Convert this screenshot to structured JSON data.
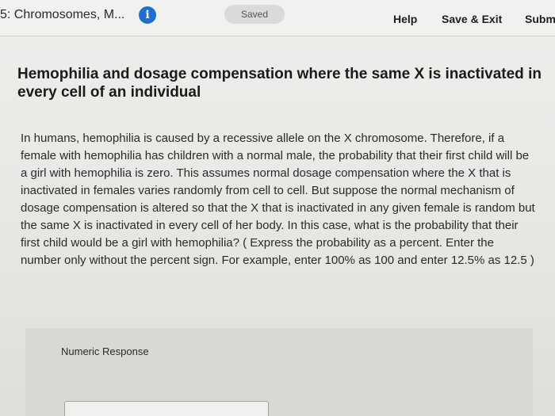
{
  "header": {
    "assignment_title": "5: Chromosomes, M...",
    "info_icon": "info-icon",
    "saved_label": "Saved",
    "help_label": "Help",
    "save_exit_label": "Save & Exit",
    "submit_label": "Subm"
  },
  "question": {
    "title": "Hemophilia and dosage compensation where the same X is inactivated in every cell of an individual",
    "prompt": "In humans, hemophilia is caused by a recessive allele on the X chromosome. Therefore, if a female with hemophilia has children with a normal male, the probability that their first child will be a girl with hemophilia is zero. This assumes normal dosage compensation where the X that is inactivated in females varies randomly from cell to cell. But suppose the normal mechanism of dosage compensation is altered so that the X that is inactivated in any given female is random but the same X is inactivated in every cell of her body. In this case, what is the probability that their first child would be a girl with hemophilia? ( Express the probability as a percent. Enter the number only without the percent sign. For example, enter 100% as 100 and enter 12.5% as 12.5 )"
  },
  "response": {
    "label": "Numeric Response",
    "value": ""
  },
  "colors": {
    "info_icon": "#1f6fd1",
    "background": "#e8e8e6",
    "panel": "#d8d8d4"
  }
}
